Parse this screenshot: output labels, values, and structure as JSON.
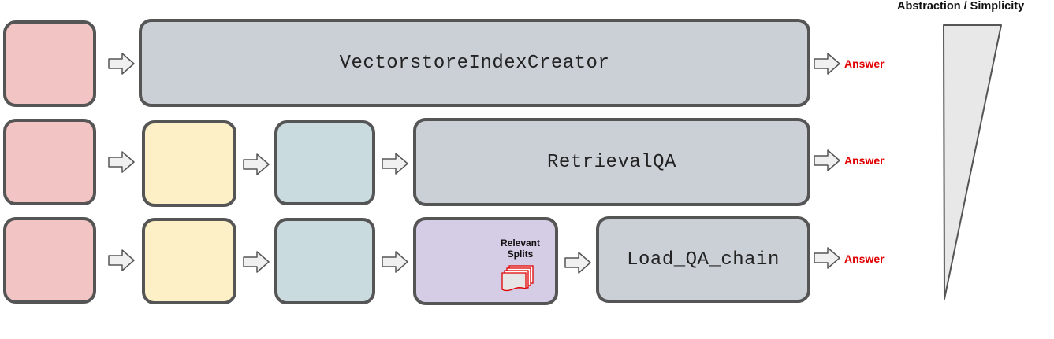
{
  "rows": [
    {
      "method_label": "VectorstoreIndexCreator",
      "output_label": "Answer"
    },
    {
      "method_label": "RetrievalQA",
      "output_label": "Answer"
    },
    {
      "method_label": "Load_QA_chain",
      "output_label": "Answer",
      "relevant_splits_label": "Relevant Splits"
    }
  ],
  "side_scale": {
    "title": "Abstraction / Simplicity"
  },
  "colors": {
    "documents": "#f2c4c4",
    "splits": "#fdf0c6",
    "vectorstore": "#c9dbdf",
    "relevant_splits": "#d5cde6",
    "method": "#cbcfd6",
    "answer": "#e00000",
    "border": "#555555"
  }
}
